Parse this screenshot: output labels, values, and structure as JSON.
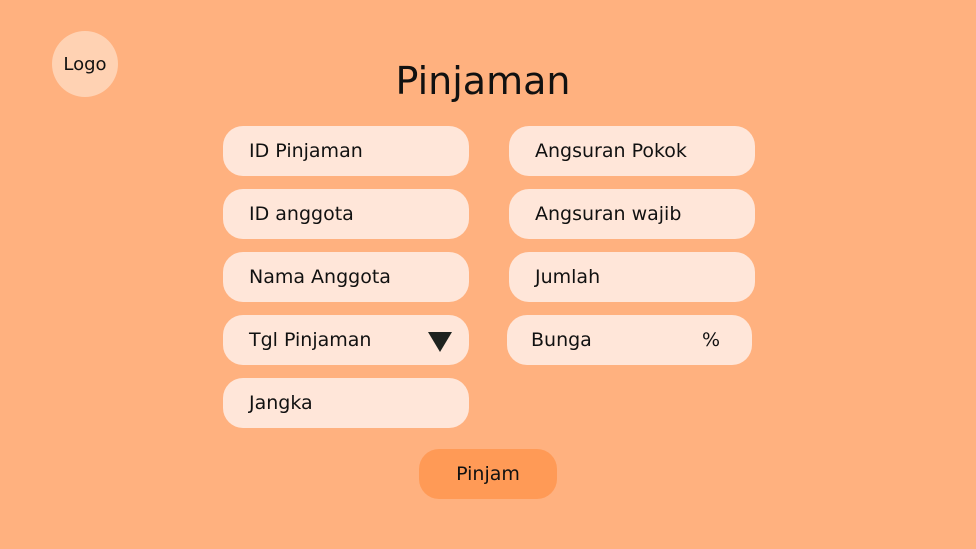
{
  "logo": {
    "label": "Logo"
  },
  "page": {
    "title": "Pinjaman"
  },
  "form": {
    "left_fields": [
      {
        "placeholder": "ID Pinjaman"
      },
      {
        "placeholder": "ID anggota"
      },
      {
        "placeholder": "Nama Anggota"
      },
      {
        "placeholder": "Tgl Pinjaman",
        "has_dropdown": true
      },
      {
        "placeholder": "Jangka"
      }
    ],
    "right_fields": [
      {
        "placeholder": "Angsuran Pokok"
      },
      {
        "placeholder": "Angsuran wajib"
      },
      {
        "placeholder": "Jumlah"
      },
      {
        "placeholder": "Bunga",
        "suffix": "%"
      }
    ],
    "submit_label": "Pinjam"
  },
  "colors": {
    "background": "#FFB17F",
    "field_background": "#FFE6D9",
    "logo_background": "#FFD2B3",
    "button_background": "#FF9A56",
    "text": "#111111"
  }
}
